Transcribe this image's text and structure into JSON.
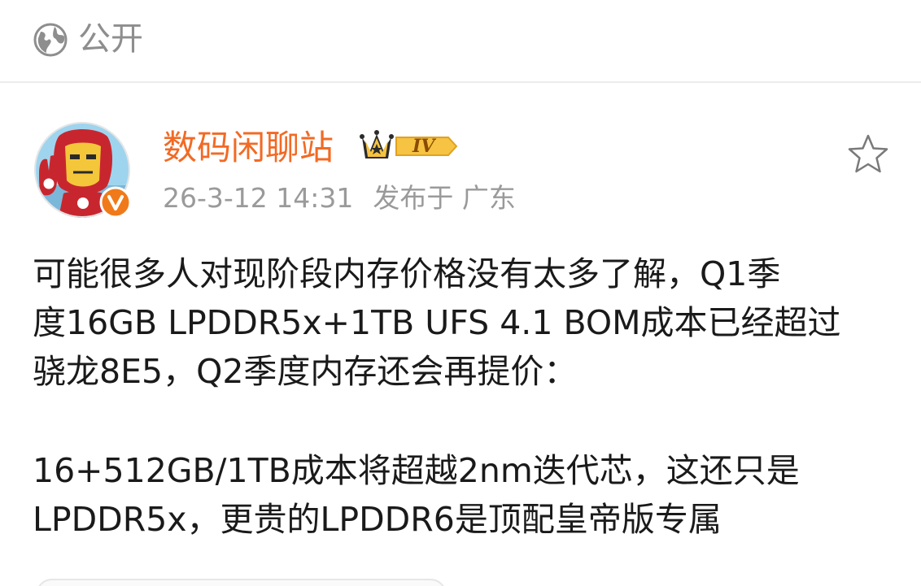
{
  "visibility": {
    "icon": "globe-icon",
    "label": "公开"
  },
  "post": {
    "author": {
      "name": "数码闲聊站",
      "avatar": "iron-man-avatar",
      "verified_icon": "verified-v-icon",
      "level_badge": "IV"
    },
    "timestamp": "26-3-12 14:31",
    "location": "发布于 广东",
    "favorite_icon": "star-outline-icon",
    "body": {
      "paragraph_1_line_1": "可能很多人对现阶段内存价格没有太多了解，Q1季",
      "paragraph_1_line_2": "度16GB LPDDR5x+1TB UFS 4.1 BOM成本已经超过",
      "paragraph_1_line_3": "骁龙8E5，Q2季度内存还会再提价：",
      "paragraph_2_line_1": "16+512GB/1TB成本将超越2nm迭代芯，这还只是",
      "paragraph_2_line_2": "LPDDR5x，更贵的LPDDR6是顶配皇帝版专属"
    }
  },
  "colors": {
    "author_name": "#f26a24",
    "meta_text": "#9a9a9a",
    "body_text": "#1a1a1a",
    "visibility_text": "#8e8e8e",
    "badge_gold": "#f6c342",
    "verified_orange": "#f07a1a"
  }
}
